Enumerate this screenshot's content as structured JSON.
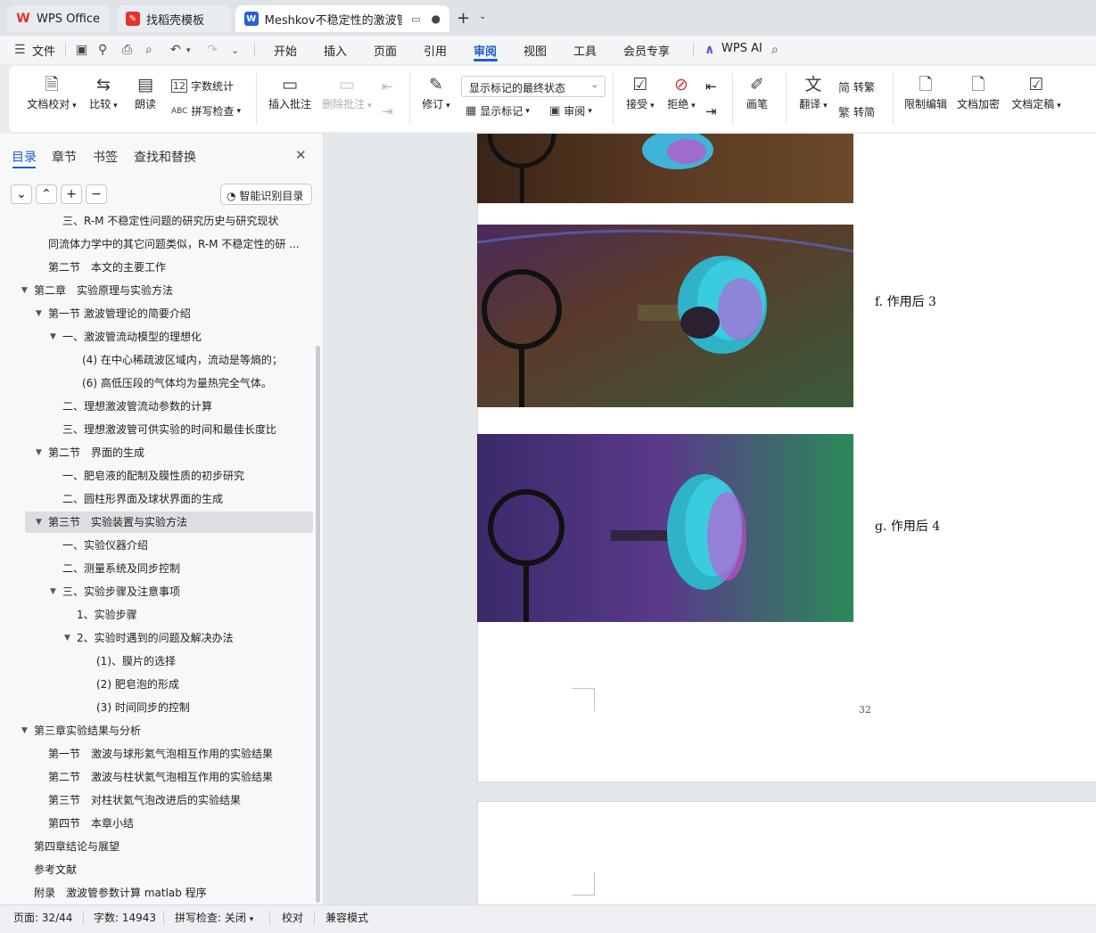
{
  "tabs": [
    {
      "label": "WPS Office",
      "icon": "wps-logo-icon",
      "color": "#e5322d"
    },
    {
      "label": "找稻壳模板",
      "icon": "docer-icon",
      "color": "#e5322d"
    },
    {
      "label": "Meshkov不稳定性的激波管实",
      "icon": "writer-doc-icon",
      "color": "#2b5fd9"
    }
  ],
  "menubar": {
    "file_label": "文件",
    "items": [
      "开始",
      "插入",
      "页面",
      "引用",
      "审阅",
      "视图",
      "工具",
      "会员专享"
    ],
    "active": "审阅",
    "ai_label": "WPS AI"
  },
  "ribbon": {
    "proofread": "文档校对",
    "compare": "比较",
    "read_aloud": "朗读",
    "word_count": "字数统计",
    "spell_check": "拼写检查",
    "insert_comment": "插入批注",
    "delete_comment": "删除批注",
    "revise": "修订",
    "display_mode": "显示标记的最终状态",
    "show_markup": "显示标记",
    "review": "审阅",
    "accept": "接受",
    "reject": "拒绝",
    "pen": "画笔",
    "translate": "翻译",
    "to_traditional": "转繁",
    "to_simplified": "转简",
    "to_traditional_icon_char": "简",
    "to_simplified_icon_char": "繁",
    "restrict_edit": "限制编辑",
    "doc_encrypt": "文档加密",
    "doc_finalize": "文档定稿"
  },
  "nav": {
    "tabs": [
      "目录",
      "章节",
      "书签",
      "查找和替换"
    ],
    "active_tab": "目录",
    "smart_toc": "智能识别目录",
    "items": [
      {
        "text": "三、R-M 不稳定性问题的研究历史与研究现状",
        "level": 3,
        "tri": ""
      },
      {
        "text": "同流体力学中的其它问题类似，R-M 不稳定性的研 ...",
        "level": 2,
        "tri": ""
      },
      {
        "text": "第二节　本文的主要工作",
        "level": 2,
        "tri": ""
      },
      {
        "text": "第二章　实验原理与实验方法",
        "level": 1,
        "tri": "▼"
      },
      {
        "text": "第一节 激波管理论的简要介绍",
        "level": 2,
        "tri": "▼"
      },
      {
        "text": "一、激波管流动模型的理想化",
        "level": 3,
        "tri": "▼"
      },
      {
        "text": "(4) 在中心稀疏波区域内，流动是等熵的；",
        "level": 5,
        "tri": ""
      },
      {
        "text": "(6) 高低压段的气体均为量热完全气体。",
        "level": 5,
        "tri": ""
      },
      {
        "text": "二、理想激波管流动参数的计算",
        "level": 3,
        "tri": ""
      },
      {
        "text": "三、理想激波管可供实验的时间和最佳长度比",
        "level": 3,
        "tri": ""
      },
      {
        "text": "第二节　界面的生成",
        "level": 2,
        "tri": "▼"
      },
      {
        "text": "一、肥皂液的配制及膜性质的初步研究",
        "level": 3,
        "tri": ""
      },
      {
        "text": "二、圆柱形界面及球状界面的生成",
        "level": 3,
        "tri": ""
      },
      {
        "text": "第三节　实验装置与实验方法",
        "level": 2,
        "tri": "▼",
        "selected": true
      },
      {
        "text": "一、实验仪器介绍",
        "level": 3,
        "tri": ""
      },
      {
        "text": "二、测量系统及同步控制",
        "level": 3,
        "tri": ""
      },
      {
        "text": "三、实验步骤及注意事项",
        "level": 3,
        "tri": "▼"
      },
      {
        "text": "1、实验步骤",
        "level": 4,
        "tri": ""
      },
      {
        "text": "2、实验时遇到的问题及解决办法",
        "level": 4,
        "tri": "▼"
      },
      {
        "text": "(1)、膜片的选择",
        "level": 6,
        "tri": ""
      },
      {
        "text": "(2) 肥皂泡的形成",
        "level": 6,
        "tri": ""
      },
      {
        "text": "(3) 时间同步的控制",
        "level": 6,
        "tri": ""
      },
      {
        "text": "第三章实验结果与分析",
        "level": 1,
        "tri": "▼"
      },
      {
        "text": "第一节　激波与球形氦气泡相互作用的实验结果",
        "level": 2,
        "tri": ""
      },
      {
        "text": "第二节　激波与柱状氦气泡相互作用的实验结果",
        "level": 2,
        "tri": ""
      },
      {
        "text": "第三节　对柱状氦气泡改进后的实验结果",
        "level": 2,
        "tri": ""
      },
      {
        "text": "第四节　本章小结",
        "level": 2,
        "tri": ""
      },
      {
        "text": "第四章结论与展望",
        "level": 1,
        "tri": ""
      },
      {
        "text": "参考文献",
        "level": 1,
        "tri": ""
      },
      {
        "text": "附录　激波管参数计算 matlab 程序",
        "level": 1,
        "tri": ""
      }
    ]
  },
  "document": {
    "captions": [
      "f. 作用后 3",
      "g. 作用后 4"
    ],
    "page_number": "32"
  },
  "statusbar": {
    "page": "页面: 32/44",
    "words": "字数: 14943",
    "spell": "拼写检查: 关闭",
    "proof": "校对",
    "compat": "兼容模式"
  }
}
